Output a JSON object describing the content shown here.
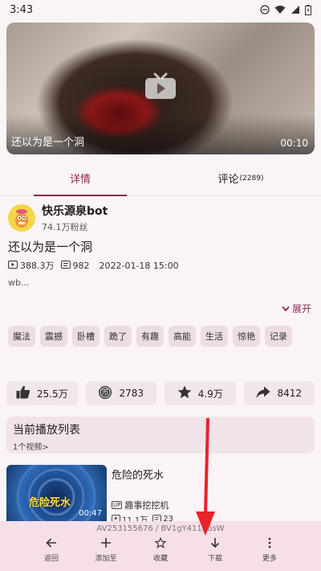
{
  "status": {
    "time": "3:43"
  },
  "video": {
    "title": "还以为是一个洞",
    "duration": "00:10"
  },
  "tabs": [
    {
      "label": "详情",
      "count": ""
    },
    {
      "label": "评论",
      "count": "(2289)"
    }
  ],
  "uploader": {
    "name": "快乐源泉bot",
    "fans": "74.1万粉丝"
  },
  "post": {
    "title": "还以为是一个洞",
    "views": "388.3万",
    "danmaku": "982",
    "date": "2022-01-18 15:00",
    "description": "wb..."
  },
  "expand_label": "展开",
  "tags": [
    "魔法",
    "震撼",
    "卧槽",
    "跪了",
    "有趣",
    "高能",
    "生活",
    "惊艳",
    "记录"
  ],
  "actions": {
    "like": "25.5万",
    "coin": "2783",
    "favorite": "4.9万",
    "share": "8412"
  },
  "playlist": {
    "title": "当前播放列表",
    "count": "1个视频>"
  },
  "recommend": {
    "title": "危险的死水",
    "thumb_text": "危险死水",
    "duration": "00:47",
    "up_badge": "UP",
    "uploader": "趣事挖挖机",
    "views": "11.1万",
    "danmaku": "23"
  },
  "bottom": {
    "av_id": "AV253155676 / BV1gY411h6sW",
    "items": [
      "返回",
      "添加至",
      "收藏",
      "下载",
      "更多"
    ]
  },
  "colors": {
    "accent": "#8a2a51",
    "annotation_arrow": "#e8232a"
  }
}
